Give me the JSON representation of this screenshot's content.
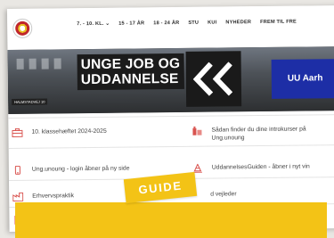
{
  "nav": {
    "items": [
      "7. - 10. KL.",
      "15 - 17 ÅR",
      "18 - 24 ÅR",
      "STU",
      "KUI",
      "NYHEDER",
      "FREM TIL FRE"
    ],
    "dropdown_icon": "chevron-down-icon"
  },
  "hero": {
    "title_line1": "UNGE JOB OG",
    "title_line2": "UDDANNELSE",
    "blue_label": "UU Aarh",
    "street_sign": "HALMSTADVEJ 10"
  },
  "links": [
    {
      "label": "10. klassehæftet 2024-2025",
      "icon": "briefcase-icon"
    },
    {
      "label": "Sådan finder du dine introkurser på",
      "label2": "Ung.unoung",
      "icon": "building-icon"
    },
    {
      "label": "Ung.unoung - login åbner på ny side",
      "icon": "mobile-icon"
    },
    {
      "label": "UddannelsesGuiden - åbner i nyt vin",
      "icon": "cone-icon"
    },
    {
      "label": "Erhvervspraktik",
      "icon": "factory-icon"
    },
    {
      "label": "d vejleder",
      "icon": ""
    },
    {
      "label": "",
      "icon": "document-icon"
    }
  ],
  "tag": {
    "label": "GUIDE"
  },
  "colors": {
    "accent": "#d9534f",
    "brand_yellow": "#f3c316",
    "brand_blue": "#1d2ea6",
    "hero_dark": "#1b1b1b"
  }
}
